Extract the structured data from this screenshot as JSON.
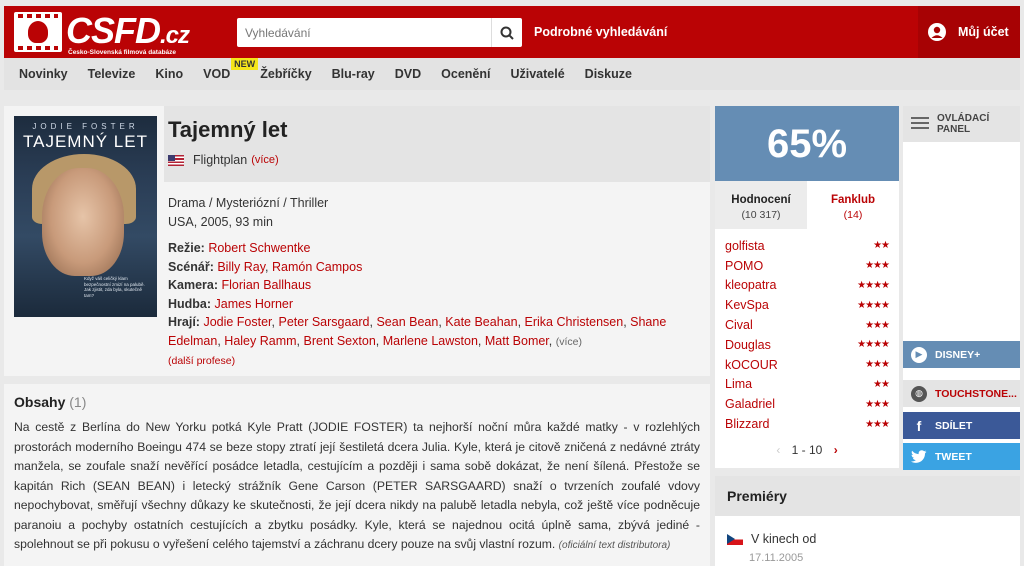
{
  "header": {
    "logo_text": "CSFD",
    "logo_suffix": ".cz",
    "logo_sub": "Česko-Slovenská filmová databáze",
    "search_placeholder": "Vyhledávání",
    "advanced_search": "Podrobné vyhledávání",
    "account": "Můj účet"
  },
  "nav": {
    "items": [
      "Novinky",
      "Televize",
      "Kino",
      "VOD",
      "Žebříčky",
      "Blu-ray",
      "DVD",
      "Ocenění",
      "Uživatelé",
      "Diskuze"
    ],
    "vod_badge": "NEW"
  },
  "film": {
    "poster": {
      "actor": "JODIE FOSTER",
      "title": "TAJEMNÝ LET",
      "blurb": "Když váš celičký klam bezpečnostní zmizí na palubě. Jak zjistit, zda byla, skutečně tam?"
    },
    "title": "Tajemný let",
    "original_title": "Flightplan",
    "original_more": "(více)",
    "genre": "Drama / Mysteriózní / Thriller",
    "meta": "USA, 2005, 93 min",
    "crew": [
      {
        "label": "Režie:",
        "names": [
          "Robert Schwentke"
        ]
      },
      {
        "label": "Scénář:",
        "names": [
          "Billy Ray",
          "Ramón Campos"
        ]
      },
      {
        "label": "Kamera:",
        "names": [
          "Florian Ballhaus"
        ]
      },
      {
        "label": "Hudba:",
        "names": [
          "James Horner"
        ]
      }
    ],
    "cast_label": "Hrají:",
    "cast": [
      "Jodie Foster",
      "Peter Sarsgaard",
      "Sean Bean",
      "Kate Beahan",
      "Erika Christensen",
      "Shane Edelman",
      "Haley Ramm",
      "Brent Sexton",
      "Marlene Lawston",
      "Matt Bomer"
    ],
    "cast_more": "(více)",
    "more_professions": "(další profese)"
  },
  "content": {
    "heading": "Obsahy",
    "count": "(1)",
    "text": "Na cestě z Berlína do New Yorku potká Kyle Pratt (JODIE FOSTER) ta nejhorší noční můra každé matky - v rozlehlých prostorách moderního Boeingu 474 se beze stopy ztratí její šestiletá dcera Julia. Kyle, která je citově zničená z nedávné ztráty manžela, se zoufale snaží nevěřící posádce letadla, cestujícím a později i sama sobě dokázat, že není šílená. Přestože se kapitán Rich (SEAN BEAN) i letecký strážník Gene Carson (PETER SARSGAARD) snaží o tvrzeních zoufalé vdovy nepochybovat, směřují všechny důkazy ke skutečnosti, že její dcera nikdy na palubě letadla nebyla, což ještě více podněcuje paranoiu a pochyby ostatních cestujících a zbytku posádky. Kyle, která se najednou ocitá úplně sama, zbývá jediné - spolehnout se při pokusu o vyřešení celého tajemství a záchranu dcery pouze na svůj vlastní rozum.",
    "distributor": "(oficiální text distributora)"
  },
  "rating": {
    "percent": "65%",
    "tab_ratings": "Hodnocení",
    "tab_ratings_count": "(10 317)",
    "tab_fanclub": "Fanklub",
    "tab_fanclub_count": "(14)",
    "users": [
      {
        "name": "golfista",
        "stars": "★★"
      },
      {
        "name": "POMO",
        "stars": "★★★"
      },
      {
        "name": "kleopatra",
        "stars": "★★★★"
      },
      {
        "name": "KevSpa",
        "stars": "★★★★"
      },
      {
        "name": "Cival",
        "stars": "★★★"
      },
      {
        "name": "Douglas",
        "stars": "★★★★"
      },
      {
        "name": "kOCOUR",
        "stars": "★★★"
      },
      {
        "name": "Lima",
        "stars": "★★"
      },
      {
        "name": "Galadriel",
        "stars": "★★★"
      },
      {
        "name": "Blizzard",
        "stars": "★★★"
      }
    ],
    "pager": "1 - 10"
  },
  "side": {
    "control_panel": "OVLÁDACÍ PANEL",
    "disney": "DISNEY+",
    "touchstone": "TOUCHSTONE...",
    "share": "SDÍLET",
    "tweet": "TWEET"
  },
  "premieres": {
    "heading": "Premiéry",
    "item": "V kinech od",
    "date": "17.11.2005"
  },
  "colors": {
    "brand_red": "#ba0305",
    "rating_blue": "#658db4",
    "facebook": "#3b5998",
    "twitter": "#3aa3e3"
  }
}
